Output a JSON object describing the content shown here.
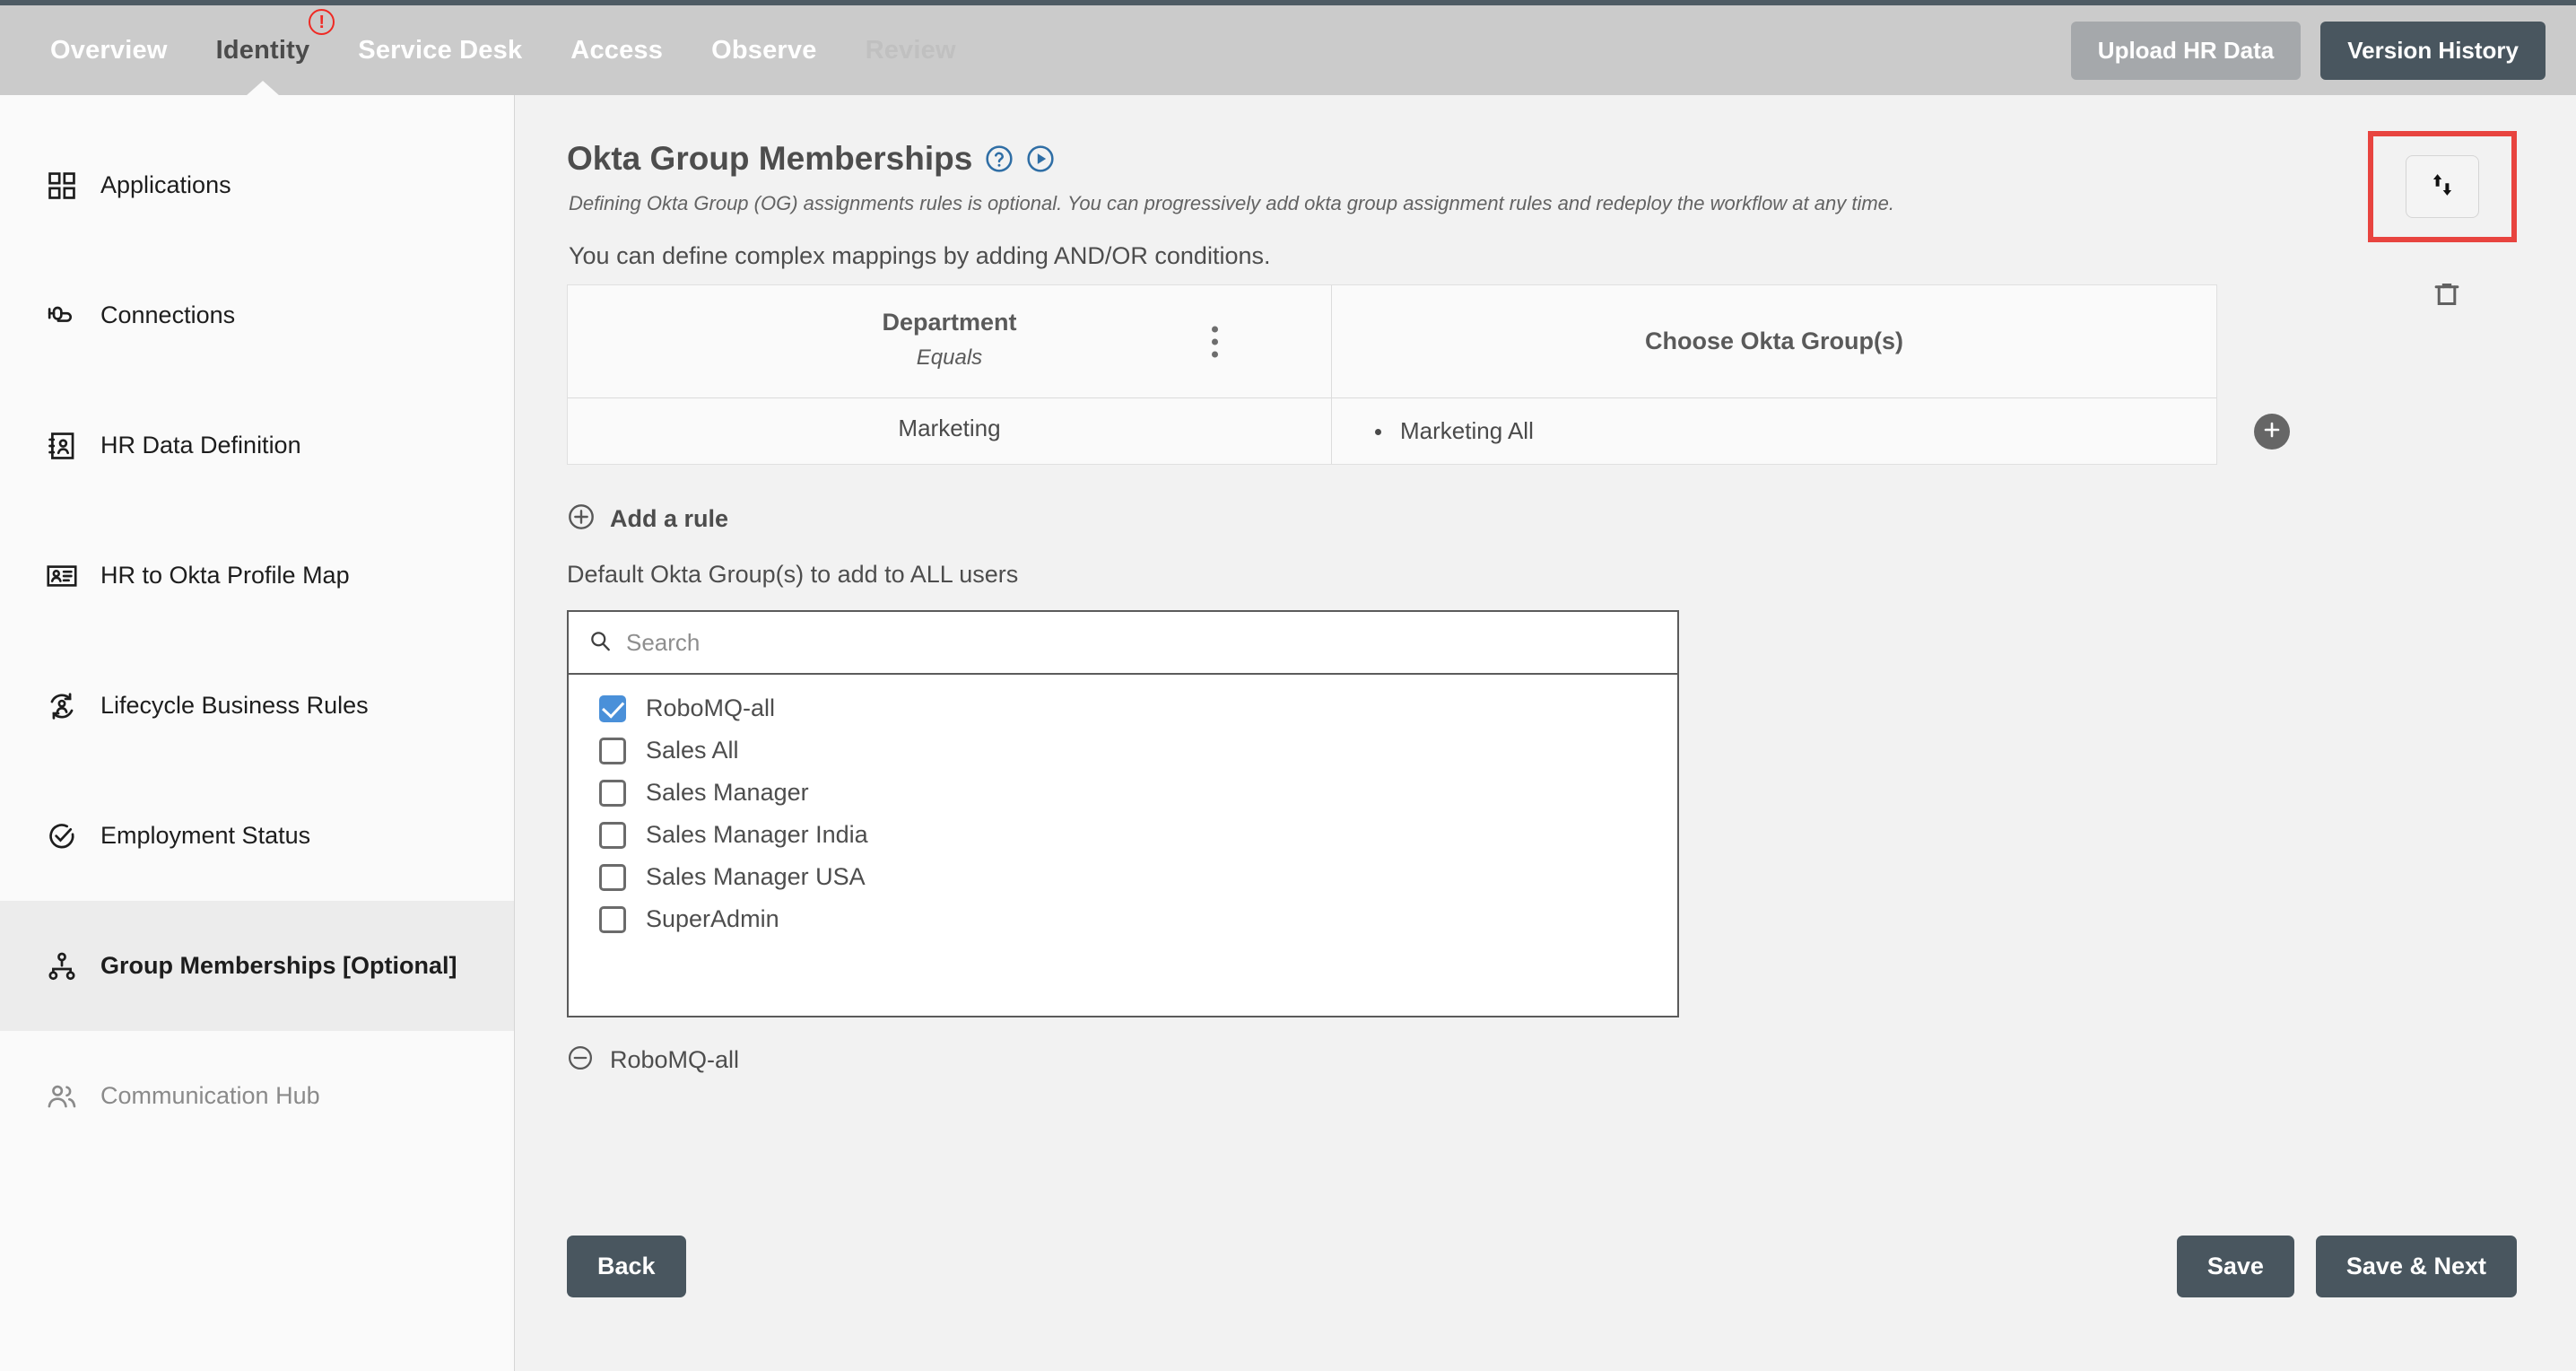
{
  "topbar": {
    "tabs": [
      {
        "label": "Overview",
        "state": "normal"
      },
      {
        "label": "Identity",
        "state": "active",
        "badge": "!"
      },
      {
        "label": "Service Desk",
        "state": "normal"
      },
      {
        "label": "Access",
        "state": "normal"
      },
      {
        "label": "Observe",
        "state": "normal"
      },
      {
        "label": "Review",
        "state": "muted"
      }
    ],
    "upload_label": "Upload HR Data",
    "version_label": "Version History"
  },
  "sidebar": {
    "items": [
      {
        "label": "Applications",
        "icon": "grid-icon",
        "state": "normal"
      },
      {
        "label": "Connections",
        "icon": "plug-icon",
        "state": "normal"
      },
      {
        "label": "HR Data Definition",
        "icon": "contact-book-icon",
        "state": "normal"
      },
      {
        "label": "HR to Okta Profile Map",
        "icon": "id-card-icon",
        "state": "normal"
      },
      {
        "label": "Lifecycle Business Rules",
        "icon": "user-cycle-icon",
        "state": "normal"
      },
      {
        "label": "Employment Status",
        "icon": "check-circle-icon",
        "state": "normal"
      },
      {
        "label": "Group Memberships [Optional]",
        "icon": "org-tree-icon",
        "state": "active"
      },
      {
        "label": "Communication Hub",
        "icon": "users-icon",
        "state": "disabled"
      }
    ]
  },
  "main": {
    "title": "Okta Group Memberships",
    "subtitle": "Defining Okta Group (OG) assignments rules is optional. You can progressively add okta group assignment rules and redeploy the workflow at any time.",
    "helper": "You can define complex mappings by adding AND/OR conditions.",
    "table": {
      "col_a_title": "Department",
      "col_a_operator": "Equals",
      "col_b_title": "Choose Okta Group(s)",
      "rows": [
        {
          "value": "Marketing",
          "groups": [
            "Marketing All"
          ]
        }
      ]
    },
    "add_rule_label": "Add a rule",
    "default_groups_label": "Default Okta Group(s) to add to ALL users",
    "search": {
      "value": "",
      "placeholder": "Search"
    },
    "options": [
      {
        "label": "RoboMQ-all",
        "checked": true
      },
      {
        "label": "Sales All",
        "checked": false
      },
      {
        "label": "Sales Manager",
        "checked": false
      },
      {
        "label": "Sales Manager India",
        "checked": false
      },
      {
        "label": "Sales Manager USA",
        "checked": false
      },
      {
        "label": "SuperAdmin",
        "checked": false
      }
    ],
    "selected_chips": [
      {
        "label": "RoboMQ-all"
      }
    ]
  },
  "footer": {
    "back_label": "Back",
    "save_label": "Save",
    "save_next_label": "Save & Next"
  },
  "colors": {
    "accent_blue": "#2f6ea5",
    "alert_red": "#ef2a24",
    "highlight_red": "#e8443f",
    "dark_button": "#49565f",
    "checkbox_blue": "#4a90d9"
  }
}
